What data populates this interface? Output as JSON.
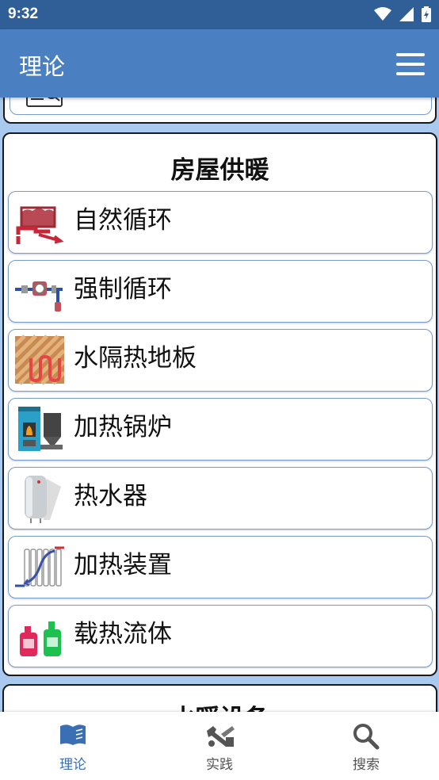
{
  "status_bar": {
    "time": "9:32"
  },
  "app_bar": {
    "title": "理论"
  },
  "section": {
    "title": "房屋供暖",
    "items": [
      {
        "label": "自然循环",
        "icon": "natural-circulation-icon"
      },
      {
        "label": "强制循环",
        "icon": "forced-circulation-icon"
      },
      {
        "label": "水隔热地板",
        "icon": "heated-floor-icon"
      },
      {
        "label": "加热锅炉",
        "icon": "boiler-icon"
      },
      {
        "label": "热水器",
        "icon": "water-heater-icon"
      },
      {
        "label": "加热装置",
        "icon": "radiator-icon"
      },
      {
        "label": "载热流体",
        "icon": "heat-fluid-icon"
      }
    ]
  },
  "next_section": {
    "title": "水暖设备"
  },
  "bottom_nav": {
    "items": [
      {
        "label": "理论",
        "icon": "book-icon",
        "active": true
      },
      {
        "label": "实践",
        "icon": "tools-icon",
        "active": false
      },
      {
        "label": "搜索",
        "icon": "search-icon",
        "active": false
      }
    ]
  },
  "colors": {
    "status_bar": "#2f5f96",
    "app_bar": "#4a7fc1",
    "background": "#a9c9ef",
    "accent": "#3a6fb3"
  }
}
